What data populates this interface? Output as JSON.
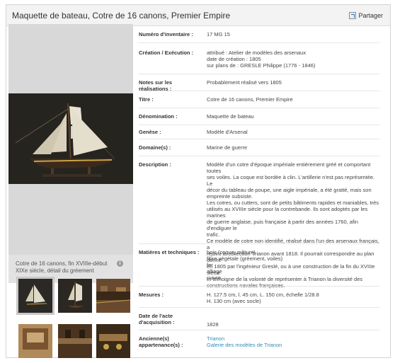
{
  "header": {
    "title": "Maquette de bateau, Cotre de 16 canons, Premier Empire",
    "share_label": "Partager"
  },
  "gallery": {
    "caption_line1": "Cotre de 16 canons, fin XVIIIe-début",
    "caption_line2": "XIXe siècle, détail du gréement",
    "info_glyph": "i"
  },
  "details": {
    "inventaire": {
      "label": "Numéro d'inventaire :",
      "value": "17 MG 15"
    },
    "creation": {
      "label": "Création / Exécution :",
      "lines": [
        "attribué : Atelier de modèles des arsenaux",
        "date de création : 1805",
        "sur plans de : GRESLE Philippe (1776 - 1846)"
      ]
    },
    "notes": {
      "label": "Notes sur les réalisations :",
      "value": "Probablement réalisé vers 1805"
    },
    "titre": {
      "label": "Titre :",
      "value": "Cotre de 16 canons, Premier Empire"
    },
    "denomination": {
      "label": "Dénomination :",
      "value": "Maquette de bateau"
    },
    "genese": {
      "label": "Genèse :",
      "value": "Modèle d'Arsenal"
    },
    "domaine": {
      "label": "Domaine(s) :",
      "value": "Marine de guerre"
    },
    "description": {
      "label": "Description :",
      "lines": [
        "Modèle d'un cotre d'époque impériale entièrement gréé et comportant toutes",
        "ses voiles. La coque est bordée à clin. L'artillerie n'est pas représentée. Le",
        "décor du tableau de poupe, une aigle impériale, a été gratté, mais son",
        "empreinte subsiste.",
        "Les cotres, ou cutters, sont de petits bâtiments rapides et maniables, très",
        "utilisés au XVIIIe siècle pour la contrebande. Ils sont adoptés par les marines",
        "de guerre anglaise, puis française à partir des années 1760, afin d'endiguer le",
        "trafic.",
        "Ce modèle de cotre non identifié, réalisé dans l'un des arsenaux français, a",
        "rejoint la collection Trianon avant 1818. Il pourrait correspondre au plan donné",
        "en 1805 par l'ingénieur Greslé, ou à une construction de la fin du XVIIIe siècle",
        "et témoigne de la volonté de représenter à Trianon la diversité des",
        "constructions navales françaises."
      ]
    },
    "materiaux": {
      "label": "Matières et techniques :",
      "lines": [
        "bois (coque, mâture)",
        "fibre végétale (gréement, voiles)",
        "fer",
        "alliage",
        "cuivre"
      ]
    },
    "mesures": {
      "label": "Mesures :",
      "lines": [
        "H. 127.5 cm, l. 45 cm, L. 150 cm, échelle 1/28.8",
        "H. 130 cm (avec socle)"
      ]
    },
    "acquisition": {
      "label_line1": "Date de l'acte",
      "label_line2": "d'acquisition :",
      "value": "1828"
    },
    "appartenance": {
      "label_line1": "Ancienne(s)",
      "label_line2": "appartenance(s) :",
      "link1": "Trianon",
      "link2": "Galerie des modèles de Trianon"
    }
  },
  "colors": {
    "link": "#2f8fb3",
    "header_bg": "#f3f3f3",
    "image_bg": "#d8d8d8"
  }
}
